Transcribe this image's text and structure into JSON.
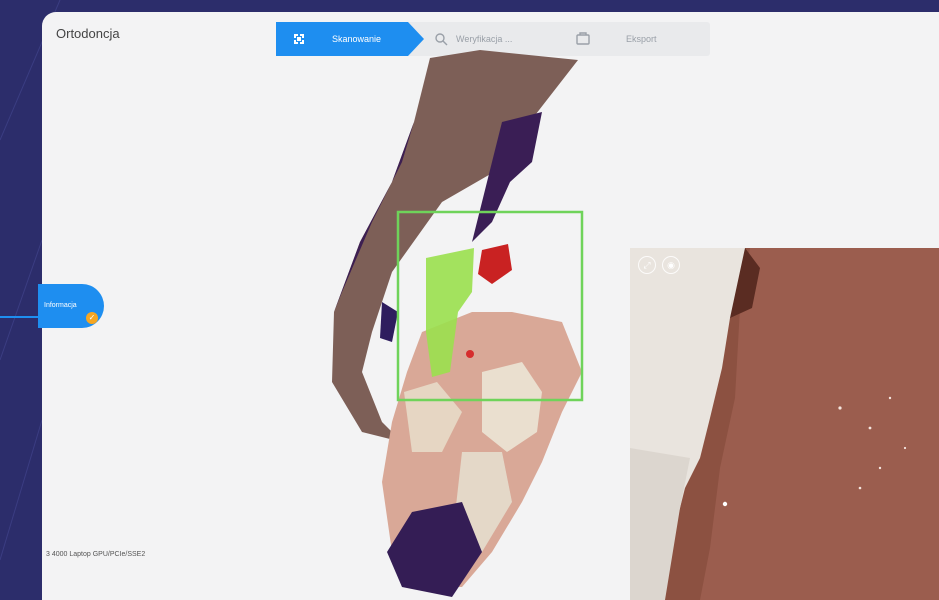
{
  "app": {
    "title": "Ortodoncja"
  },
  "steps": [
    {
      "label": "Skanowanie",
      "icon": "scan-icon",
      "active": true
    },
    {
      "label": "Weryfikacja ...",
      "icon": "verify-icon",
      "active": false
    },
    {
      "label": "Eksport",
      "icon": "export-icon",
      "active": false
    }
  ],
  "chat": {
    "label": "Informacja",
    "badge_icon": "check-icon"
  },
  "status": {
    "device": "3 4000 Laptop GPU/PCIe/SSE2"
  },
  "camera": {
    "buttons": [
      "expand-icon",
      "camera-icon"
    ]
  },
  "colors": {
    "accent": "#1e8ef0",
    "roi": "#6fd35a",
    "background": "#2c2d6b",
    "panel": "#f3f3f4"
  }
}
